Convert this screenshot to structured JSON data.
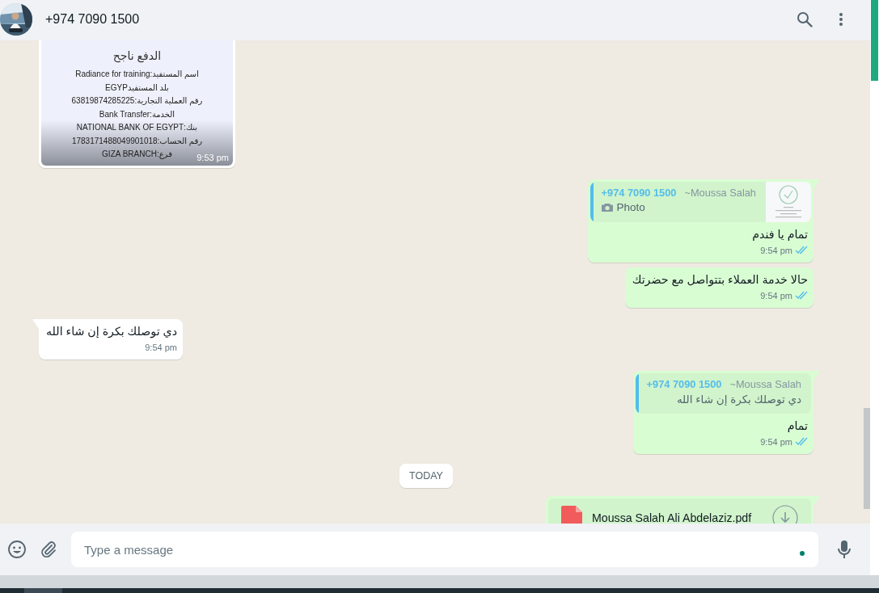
{
  "header": {
    "title": "+974 7090 1500"
  },
  "messages": [
    {
      "kind": "message",
      "outgoing": false,
      "receipt": {
        "title": "الدفع ناجح",
        "lines": [
          "اسم المستفيد:Radiance for training",
          "بلد المستفيدEGYP",
          "رقم العملية التجارية:63819874285225",
          "الخدمة:Bank Transfer",
          "بنك:NATIONAL BANK OF EGYPT",
          "رقم الحساب:1783171488049901018",
          "فرع:GIZA BRANCH"
        ]
      },
      "time": "9:53 pm"
    },
    {
      "kind": "message",
      "outgoing": true,
      "quote": {
        "author": "+974 7090 1500",
        "sender": "~Moussa Salah",
        "media": {
          "label": "Photo"
        }
      },
      "text": "تمام يا فندم",
      "time": "9:54 pm",
      "read": true
    },
    {
      "kind": "message",
      "outgoing": true,
      "text": "حالا خدمة العملاء بتتواصل مع حضرتك",
      "time": "9:54 pm",
      "read": true
    },
    {
      "kind": "message",
      "outgoing": false,
      "text": "دي توصلك بكرة إن شاء الله",
      "time": "9:54 pm"
    },
    {
      "kind": "message",
      "outgoing": true,
      "quote": {
        "author": "+974 7090 1500",
        "sender": "~Moussa Salah",
        "text": "دي توصلك بكرة إن شاء الله"
      },
      "text": "تمام",
      "time": "9:54 pm",
      "read": true
    },
    {
      "kind": "date",
      "label": "TODAY"
    },
    {
      "kind": "message",
      "outgoing": true,
      "document": {
        "name": "Moussa Salah Ali Abdelaziz.pdf"
      }
    }
  ],
  "composer": {
    "placeholder": "Type a message"
  }
}
